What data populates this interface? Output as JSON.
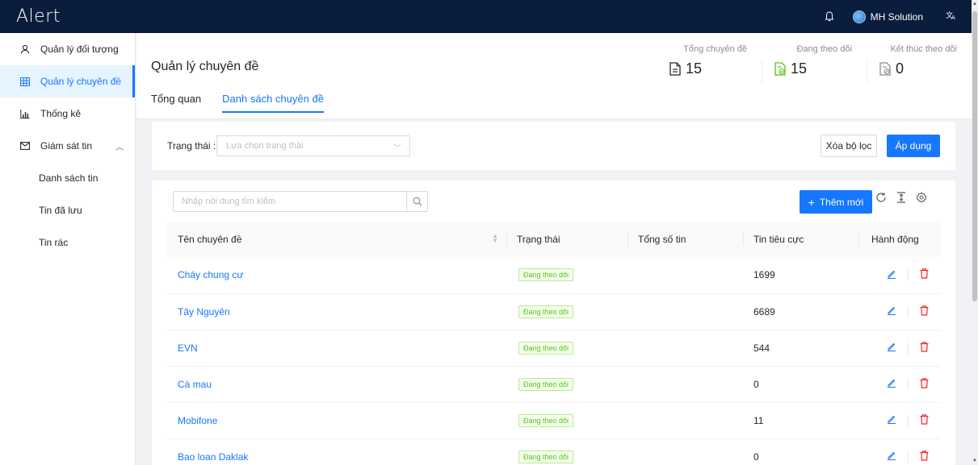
{
  "app": {
    "logo": "Alert",
    "user_name": "MH Solution",
    "lang_icon": "translate-icon"
  },
  "sidebar": {
    "items": [
      {
        "label": "Quản lý đối tượng",
        "icon": "user-icon"
      },
      {
        "label": "Quản lý chuyên đề",
        "icon": "table-icon",
        "active": true
      },
      {
        "label": "Thống kê",
        "icon": "bar-chart-icon"
      },
      {
        "label": "Giám sát tin",
        "icon": "mail-icon",
        "expanded": true
      }
    ],
    "sub_items": [
      {
        "label": "Danh sách tin"
      },
      {
        "label": "Tin đã lưu"
      },
      {
        "label": "Tin rác"
      }
    ]
  },
  "header": {
    "title": "Quản lý chuyên đề",
    "tabs": [
      {
        "label": "Tổng quan"
      },
      {
        "label": "Danh sách chuyên đề",
        "active": true
      }
    ],
    "stats": [
      {
        "label": "Tổng chuyên đề",
        "value": "15"
      },
      {
        "label": "Đang theo dõi",
        "value": "15"
      },
      {
        "label": "Kết thúc theo dõi",
        "value": "0"
      }
    ]
  },
  "filter": {
    "label": "Trạng thái :",
    "placeholder": "Lựa chọn trạng thái",
    "clear_label": "Xóa bộ lọc",
    "apply_label": "Áp dụng"
  },
  "list": {
    "search_placeholder": "Nhập nội dung tìm kiếm",
    "add_label": "Thêm mới",
    "columns": [
      "Tên chuyên đề",
      "Trạng thái",
      "Tổng số tin",
      "Tin tiêu cực",
      "Hành động"
    ],
    "rows": [
      {
        "name": "Cháy chung cư",
        "status": "Đang theo dõi",
        "total": "",
        "negative": "1699"
      },
      {
        "name": "Tây Nguyên",
        "status": "Đang theo dõi",
        "total": "",
        "negative": "6689"
      },
      {
        "name": "EVN",
        "status": "Đang theo dõi",
        "total": "",
        "negative": "544"
      },
      {
        "name": "Cà mau",
        "status": "Đang theo dõi",
        "total": "",
        "negative": "0"
      },
      {
        "name": "Mobifone",
        "status": "Đang theo dõi",
        "total": "",
        "negative": "11"
      },
      {
        "name": "Bao loan Daklak",
        "status": "Đang theo dõi",
        "total": "",
        "negative": "0"
      }
    ]
  },
  "colors": {
    "primary": "#1677ff",
    "topbar": "#0b1d3d",
    "success": "#52c41a",
    "danger": "#f5222d"
  }
}
